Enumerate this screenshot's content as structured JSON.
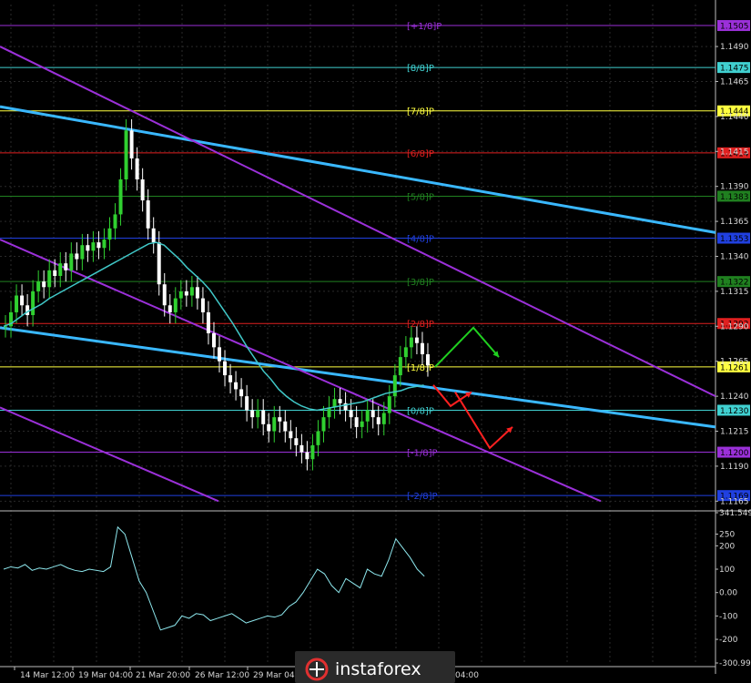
{
  "chart_data": {
    "type": "candlestick",
    "main_panel": {
      "y_ticks": [
        1.1165,
        1.119,
        1.1215,
        1.124,
        1.1265,
        1.129,
        1.1315,
        1.134,
        1.1365,
        1.139,
        1.1415,
        1.144,
        1.1465,
        1.149
      ],
      "ylim": [
        1.116,
        1.152
      ],
      "murrey_levels": [
        {
          "label": "[+1/8]P",
          "value": 1.1505,
          "color": "#9b30d9",
          "badge": "1.1505"
        },
        {
          "label": "[8/8]P",
          "value": 1.1475,
          "color": "#40d0d0",
          "badge": "1.1475"
        },
        {
          "label": "[7/8]P",
          "value": 1.1444,
          "color": "#ffff40",
          "badge": "1.1444"
        },
        {
          "label": "[6/8]P",
          "value": 1.1414,
          "color": "#e02020",
          "badge": "1.1414"
        },
        {
          "label": "[5/8]P",
          "value": 1.1383,
          "color": "#208020",
          "badge": "1.1383"
        },
        {
          "label": "[4/8]P",
          "value": 1.1353,
          "color": "#2040e0",
          "badge": "1.1353"
        },
        {
          "label": "[3/8]P",
          "value": 1.1322,
          "color": "#208020",
          "badge": "1.1322"
        },
        {
          "label": "[2/8]P",
          "value": 1.1292,
          "color": "#e02020",
          "badge": "1.1292"
        },
        {
          "label": "[1/8]P",
          "value": 1.1261,
          "color": "#ffff40",
          "badge": "1.1261"
        },
        {
          "label": "[0/8]P",
          "value": 1.123,
          "color": "#40d0d0",
          "badge": "1.1230"
        },
        {
          "label": "[-1/8]P",
          "value": 1.12,
          "color": "#9b30d9",
          "badge": "1.1200"
        },
        {
          "label": "[-2/8]P",
          "value": 1.1169,
          "color": "#2040e0",
          "badge": "1.1169"
        }
      ],
      "candles_close": [
        1.129,
        1.13,
        1.1312,
        1.1305,
        1.1298,
        1.1315,
        1.1322,
        1.1318,
        1.133,
        1.1326,
        1.1335,
        1.133,
        1.1342,
        1.1338,
        1.1348,
        1.1344,
        1.135,
        1.1346,
        1.1352,
        1.136,
        1.137,
        1.1395,
        1.143,
        1.141,
        1.1395,
        1.138,
        1.136,
        1.135,
        1.132,
        1.1305,
        1.13,
        1.131,
        1.1315,
        1.1312,
        1.1318,
        1.131,
        1.13,
        1.1285,
        1.1275,
        1.1265,
        1.1255,
        1.125,
        1.1245,
        1.124,
        1.123,
        1.1225,
        1.123,
        1.122,
        1.1215,
        1.1225,
        1.1222,
        1.1215,
        1.121,
        1.1205,
        1.12,
        1.1195,
        1.1205,
        1.1215,
        1.1225,
        1.1232,
        1.1238,
        1.1235,
        1.123,
        1.1225,
        1.1218,
        1.1222,
        1.123,
        1.1225,
        1.122,
        1.1228,
        1.124,
        1.1255,
        1.1268,
        1.1275,
        1.1282,
        1.1278,
        1.127,
        1.1262
      ],
      "moving_average": [
        1.129,
        1.1292,
        1.1296,
        1.13,
        1.1303,
        1.1306,
        1.131,
        1.1313,
        1.1316,
        1.1319,
        1.1322,
        1.1325,
        1.1328,
        1.1331,
        1.1334,
        1.1337,
        1.134,
        1.1343,
        1.1346,
        1.1349,
        1.135,
        1.1348,
        1.1343,
        1.1338,
        1.1332,
        1.1327,
        1.1322,
        1.1316,
        1.1308,
        1.13,
        1.1292,
        1.1283,
        1.1274,
        1.1266,
        1.1258,
        1.1252,
        1.1245,
        1.124,
        1.1236,
        1.1233,
        1.1231,
        1.123,
        1.1231,
        1.1232,
        1.1233,
        1.1234,
        1.1235,
        1.1236,
        1.1238,
        1.124,
        1.1242,
        1.1243,
        1.1244,
        1.1246,
        1.1247,
        1.1248
      ],
      "channel_lines": [
        {
          "color": "#3ab8ff",
          "from": 1.1447,
          "to": 1.1357
        },
        {
          "color": "#3ab8ff",
          "from": 1.1289,
          "to": 1.1218
        },
        {
          "color": "#9b30d9",
          "from": 1.149,
          "to": 1.124
        },
        {
          "color": "#9b30d9",
          "from": 1.1352,
          "to": 1.1165
        },
        {
          "color": "#9b30d9",
          "from": 1.1232,
          "to": 1.1165
        }
      ],
      "forecast_arrows": [
        {
          "color": "#20d020",
          "points": [
            [
              1.1261,
              0
            ],
            [
              1.1289,
              1
            ],
            [
              1.1268,
              2
            ]
          ]
        },
        {
          "color": "#ff2020",
          "points": [
            [
              1.1248,
              0
            ],
            [
              1.1233,
              1
            ],
            [
              1.1243,
              2
            ]
          ]
        },
        {
          "color": "#ff2020",
          "points": [
            [
              1.1243,
              0
            ],
            [
              1.1203,
              1
            ],
            [
              1.1218,
              2
            ]
          ]
        }
      ]
    },
    "oscillator_panel": {
      "y_ticks": [
        341.5495,
        250,
        200,
        100,
        0.0,
        -100,
        -200,
        -300.994
      ],
      "y_tick_labels": [
        "341.5495",
        "250",
        "200",
        "100",
        "0.00",
        "-100",
        "-200",
        "-300.994"
      ],
      "ylim": [
        -300.994,
        341.5495
      ],
      "values": [
        100,
        110,
        105,
        120,
        95,
        105,
        100,
        110,
        120,
        105,
        95,
        90,
        100,
        95,
        90,
        110,
        280,
        250,
        150,
        50,
        0,
        -80,
        -160,
        -150,
        -140,
        -100,
        -110,
        -90,
        -95,
        -120,
        -110,
        -100,
        -90,
        -110,
        -130,
        -120,
        -110,
        -100,
        -105,
        -95,
        -60,
        -40,
        0,
        50,
        100,
        80,
        30,
        0,
        60,
        40,
        20,
        100,
        80,
        70,
        140,
        230,
        190,
        150,
        100,
        70
      ]
    },
    "x_tick_labels": [
      "14 Mar 12:00",
      "19 Mar 04:00",
      "21 Mar 20:00",
      "26 Mar 12:00",
      "29 Mar 04:",
      "04:00"
    ]
  },
  "logo": {
    "text": "instaforex"
  }
}
